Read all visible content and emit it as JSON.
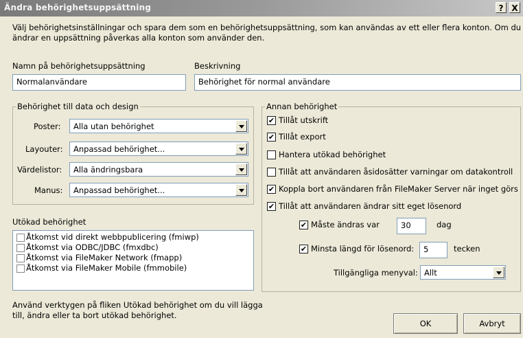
{
  "window": {
    "title": "Ändra behörighetsuppsättning",
    "help_label": "?",
    "close_label": "X"
  },
  "intro": {
    "line1": "Välj behörighetsinställningar och spara dem som en behörighetsuppsättning, som kan användas av ett eller flera konton. Om du",
    "line2": "ändrar en uppsättning påverkas alla konton som använder den."
  },
  "name_field": {
    "label": "Namn på behörighetsuppsättning",
    "value": "Normalanvändare"
  },
  "description_field": {
    "label": "Beskrivning",
    "value": "Behörighet för normal användare"
  },
  "data_design": {
    "title": "Behörighet till data och design",
    "records": {
      "label": "Poster:",
      "value": "Alla utan behörighet"
    },
    "layouts": {
      "label": "Layouter:",
      "value": "Anpassad behörighet..."
    },
    "value_lists": {
      "label": "Värdelistor:",
      "value": "Alla ändringsbara"
    },
    "scripts": {
      "label": "Manus:",
      "value": "Anpassad behörighet..."
    }
  },
  "extended": {
    "title": "Utökad behörighet",
    "items": [
      {
        "label": "Åtkomst vid direkt webbpublicering (fmiwp)",
        "checked": false
      },
      {
        "label": "Åtkomst via ODBC/JDBC (fmxdbc)",
        "checked": false
      },
      {
        "label": "Åtkomst via FileMaker Network (fmapp)",
        "checked": false
      },
      {
        "label": "Åtkomst via FileMaker Mobile (fmmobile)",
        "checked": false
      }
    ],
    "hint_line1": "Använd verktygen på fliken Utökad behörighet om du vill lägga",
    "hint_line2": "till, ändra eller ta bort utökad behörighet."
  },
  "other": {
    "title": "Annan behörighet",
    "allow_print": {
      "label": "Tillåt utskrift",
      "checked": true
    },
    "allow_export": {
      "label": "Tillåt export",
      "checked": true
    },
    "manage_extended": {
      "label": "Hantera utökad behörighet",
      "checked": false
    },
    "override_validation": {
      "label": "Tillåt att användaren åsidosätter varningar om datakontroll",
      "checked": false
    },
    "disconnect_idle": {
      "label": "Koppla bort användaren från FileMaker Server när inget görs",
      "checked": true
    },
    "change_password": {
      "label": "Tillåt att användaren ändrar sitt eget lösenord",
      "checked": true
    },
    "must_change": {
      "label": "Måste ändras var",
      "value": "30",
      "unit": "dag",
      "checked": true
    },
    "min_length": {
      "label": "Minsta längd för lösenord:",
      "value": "5",
      "unit": "tecken",
      "checked": true
    },
    "menu_options": {
      "label": "Tillgängliga menyval:",
      "value": "Allt"
    }
  },
  "buttons": {
    "ok": "OK",
    "cancel": "Avbryt"
  },
  "checkmark": "✔"
}
